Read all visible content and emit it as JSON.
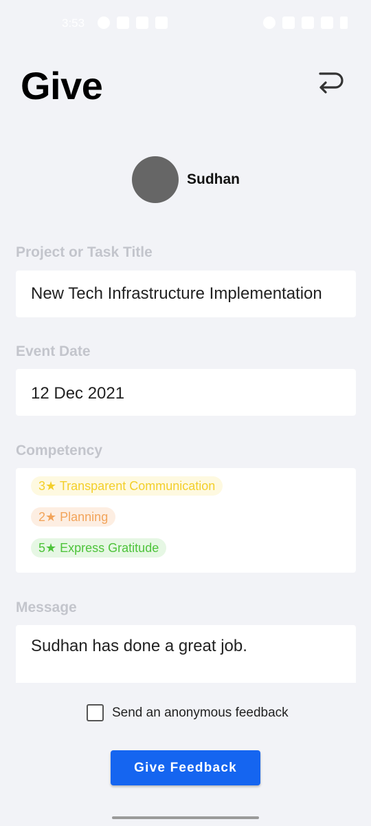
{
  "status_bar": {
    "time": "3:53"
  },
  "header": {
    "title": "Give"
  },
  "recipient": {
    "name": "Sudhan"
  },
  "project": {
    "label": "Project or Task Title",
    "value": "New Tech Infrastructure Implementation"
  },
  "event_date": {
    "label": "Event Date",
    "value": "12 Dec 2021"
  },
  "competency": {
    "label": "Competency",
    "items": [
      {
        "text": "3★ Transparent Communication",
        "color": "#f3cf2a"
      },
      {
        "text": "2★ Planning",
        "color": "#f2a45a"
      },
      {
        "text": "5★ Express Gratitude",
        "color": "#4dc33a"
      }
    ]
  },
  "message": {
    "label": "Message",
    "value": "Sudhan has done a great job."
  },
  "anonymous": {
    "label": "Send an anonymous feedback",
    "checked": false
  },
  "submit": {
    "label": "Give Feedback"
  },
  "colors": {
    "accent": "#1565f0",
    "background": "#f2f3f7",
    "label": "#c3c5cc"
  }
}
